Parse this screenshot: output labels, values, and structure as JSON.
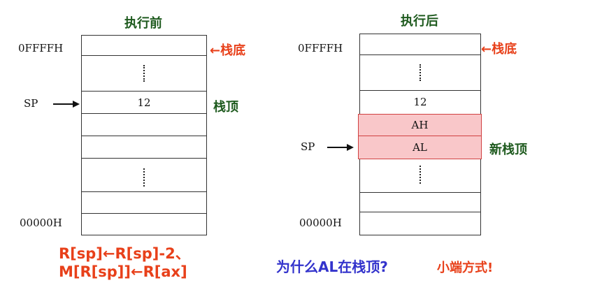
{
  "left": {
    "title": "执行前",
    "top_addr": "0FFFFH",
    "bottom_addr": "00000H",
    "sp_label": "SP",
    "value_12": "12",
    "bottom_label": "←栈底",
    "top_label": "栈顶"
  },
  "right": {
    "title": "执行后",
    "top_addr": "0FFFFH",
    "bottom_addr": "00000H",
    "sp_label": "SP",
    "value_12": "12",
    "ah": "AH",
    "al": "AL",
    "bottom_label": "←栈底",
    "top_label": "新栈顶"
  },
  "formula": {
    "line1": "R[sp]←R[sp]-2、",
    "line2": "M[R[sp]]←R[ax]"
  },
  "question": "为什么AL在栈顶?",
  "answer": "小端方式!",
  "colors": {
    "green": "#1e5a1e",
    "red_orange": "#e8401a",
    "blue": "#3333cc",
    "highlight": "#f9c7c9"
  }
}
